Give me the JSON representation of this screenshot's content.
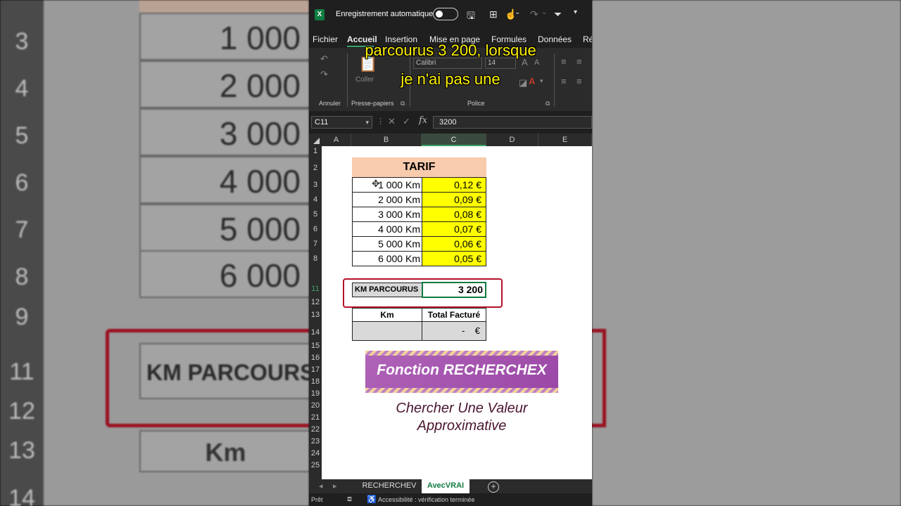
{
  "background": {
    "row_numbers": [
      "3",
      "4",
      "5",
      "6",
      "7",
      "8",
      "9",
      "11",
      "12",
      "13",
      "14"
    ],
    "values": [
      "1 000",
      "2 000",
      "3 000",
      "4 000",
      "5 000",
      "6 000"
    ],
    "km_parcours_label": "KM PARCOURS",
    "km_label": "Km"
  },
  "titlebar": {
    "autosave_label": "Enregistrement automatique",
    "toolbar_icons": [
      "save-icon",
      "undo-icon",
      "redo-icon",
      "filter-icon",
      "more-icon"
    ]
  },
  "menu": {
    "items": [
      "Fichier",
      "Accueil",
      "Insertion",
      "Mise en page",
      "Formules",
      "Données",
      "Ré"
    ],
    "active": "Accueil"
  },
  "ribbon": {
    "undo_label": "Annuler",
    "clipboard_label": "Presse-papiers",
    "paste_label": "Coller",
    "font_label": "Police",
    "font_name": "Calibri",
    "font_size": "14"
  },
  "subtitle": {
    "line1": "parcourus 3 200,  lorsque",
    "line2": "je n'ai pas une"
  },
  "formula_bar": {
    "cell_ref": "C11",
    "value": "3200"
  },
  "columns": [
    "A",
    "B",
    "C",
    "D",
    "E"
  ],
  "selected_column": "C",
  "rows": [
    "1",
    "2",
    "3",
    "4",
    "5",
    "6",
    "7",
    "8",
    "11",
    "12",
    "13",
    "14",
    "15",
    "16",
    "17",
    "18",
    "19",
    "20",
    "21",
    "22",
    "23",
    "24",
    "25"
  ],
  "selected_row": "11",
  "sheet": {
    "tarif_title": "TARIF",
    "tarif_rows": [
      {
        "km": "1 000 Km",
        "price": "0,12 €"
      },
      {
        "km": "2 000 Km",
        "price": "0,09 €"
      },
      {
        "km": "3 000 Km",
        "price": "0,08 €"
      },
      {
        "km": "4 000 Km",
        "price": "0,07 €"
      },
      {
        "km": "5 000 Km",
        "price": "0,06 €"
      },
      {
        "km": "6 000 Km",
        "price": "0,05 €"
      }
    ],
    "km_parcourus_label": "KM PARCOURUS",
    "km_parcourus_value": "3 200",
    "km_header": "Km",
    "total_header": "Total Facturé",
    "total_value": "-    €"
  },
  "banner": {
    "title": "Fonction RECHERCHEX",
    "caption_line1": "Chercher Une Valeur",
    "caption_line2": "Approximative"
  },
  "tabs": {
    "items": [
      "RECHERCHEV",
      "AvecVRAI"
    ],
    "active": "AvecVRAI"
  },
  "status": {
    "ready": "Prêt",
    "accessibility": "Accessibilité : vérification terminée"
  },
  "colors": {
    "excel_green": "#107c41",
    "tarif_header": "#f8cbad",
    "price_fill": "#ffff00",
    "annotation_red": "#b4122a",
    "banner_purple": "#a452ae",
    "subtitle_yellow": "#fff200"
  }
}
